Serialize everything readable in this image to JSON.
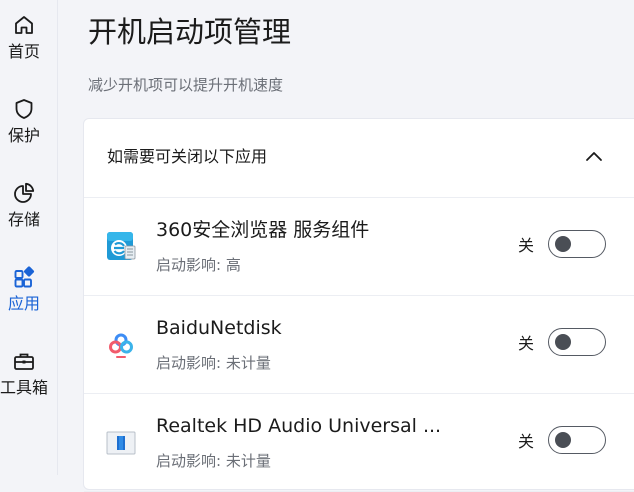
{
  "sidebar": {
    "items": [
      {
        "label": "首页",
        "icon": "home-icon"
      },
      {
        "label": "保护",
        "icon": "shield-icon"
      },
      {
        "label": "存储",
        "icon": "pie-chart-icon"
      },
      {
        "label": "应用",
        "icon": "apps-icon",
        "active": true
      },
      {
        "label": "工具箱",
        "icon": "toolbox-icon"
      }
    ]
  },
  "main": {
    "title": "开机启动项管理",
    "subtitle": "减少开机项可以提升开机速度",
    "section": {
      "header": "如需要可关闭以下应用",
      "collapse_icon": "chevron-up-icon",
      "apps": [
        {
          "name": "360安全浏览器 服务组件",
          "impact": "启动影响: 高",
          "toggle_label": "关",
          "enabled": false,
          "icon": "browser-360-icon"
        },
        {
          "name": "BaiduNetdisk",
          "impact": "启动影响: 未计量",
          "toggle_label": "关",
          "enabled": false,
          "icon": "baidu-netdisk-icon"
        },
        {
          "name": "Realtek HD Audio Universal ...",
          "impact": "启动影响: 未计量",
          "toggle_label": "关",
          "enabled": false,
          "icon": "realtek-audio-icon"
        }
      ]
    }
  },
  "colors": {
    "accent": "#1a63d6",
    "background": "#f3f4f8",
    "card": "#ffffff",
    "muted_text": "#6b6f77"
  }
}
